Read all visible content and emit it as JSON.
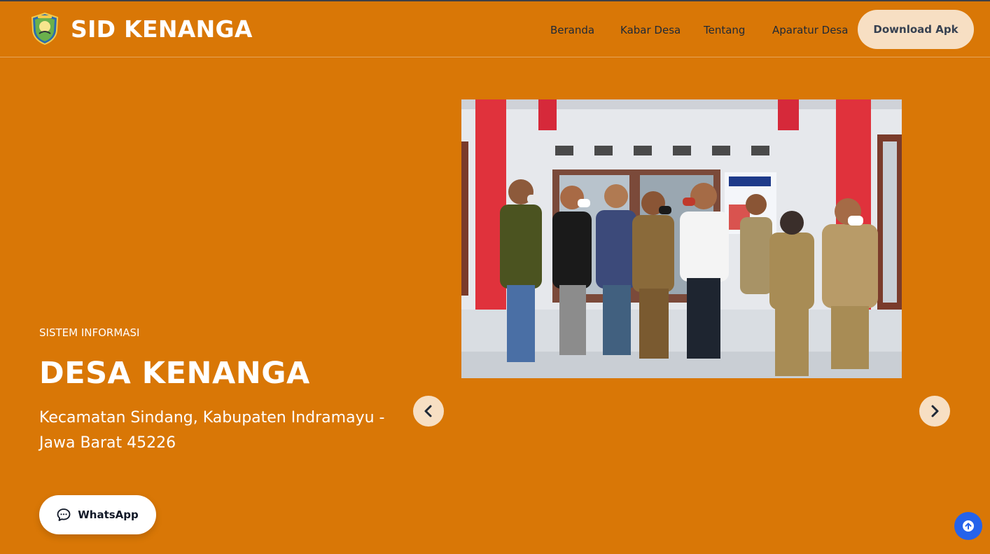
{
  "brand": {
    "name": "SID KENANGA",
    "logo_icon": "village-emblem-icon"
  },
  "nav": {
    "links": [
      "Beranda",
      "Kabar Desa",
      "Tentang",
      "Aparatur Desa"
    ],
    "download_label": "Download Apk"
  },
  "hero": {
    "eyebrow": "SISTEM INFORMASI",
    "title": "DESA KENANGA",
    "subtitle": "Kecamatan Sindang, Kabupaten Indramayu - Jawa Barat 45226",
    "whatsapp_label": "WhatsApp"
  },
  "carousel": {
    "prev_icon": "chevron-left-icon",
    "next_icon": "chevron-right-icon"
  },
  "colors": {
    "background": "#d97706",
    "nav_text": "#1f2937",
    "button_cream": "#f7dfc3",
    "scroll_top_blue": "#2563eb"
  }
}
